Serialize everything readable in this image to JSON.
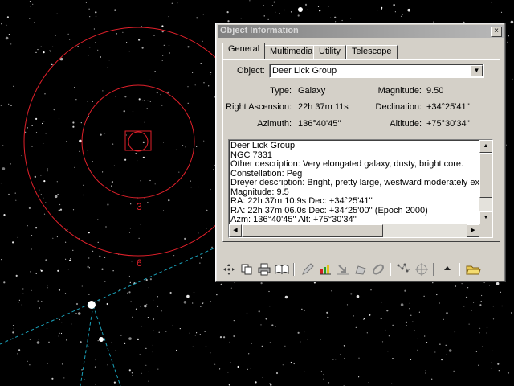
{
  "window": {
    "title": "Object Information",
    "close_glyph": "×"
  },
  "tabs": [
    {
      "label": "General",
      "active": true
    },
    {
      "label": "Multimedia",
      "active": false
    },
    {
      "label": "Utility",
      "active": false
    },
    {
      "label": "Telescope",
      "active": false
    }
  ],
  "general": {
    "object_label": "Object:",
    "object_value": "Deer Lick Group",
    "type_label": "Type:",
    "type_value": "Galaxy",
    "magnitude_label": "Magnitude:",
    "magnitude_value": "9.50",
    "ra_label": "Right Ascension:",
    "ra_value": "22h 37m 11s",
    "dec_label": "Declination:",
    "dec_value": "+34°25'41''",
    "azimuth_label": "Azimuth:",
    "azimuth_value": "136°40'45''",
    "altitude_label": "Altitude:",
    "altitude_value": "+75°30'34''"
  },
  "description": [
    "Deer Lick Group",
    "NGC 7331",
    "Other description: Very elongated galaxy, dusty, bright core.",
    "Constellation:  Peg",
    "Dreyer description: Bright, pretty large, westward moderately exten",
    "Magnitude:  9.5",
    "RA: 22h 37m 10.9s  Dec: +34°25'41''",
    "RA: 22h 37m 06.0s  Dec: +34°25'00''  (Epoch 2000)",
    "Azm: 136°40'45''  Alt: +75°30'34''"
  ],
  "sky": {
    "ring_labels": [
      "3",
      "6"
    ],
    "ring_color": "#e0202a",
    "line_color": "#1aa0b8"
  },
  "toolbar": [
    "center-object-icon",
    "copy-icon",
    "print-icon",
    "open-book-icon",
    "pencil-icon",
    "chart-edit-icon",
    "arrow-down-icon",
    "palette-icon",
    "link-icon",
    "constellation-icon",
    "crosshair-icon",
    "up-arrow-icon",
    "open-folder-icon"
  ]
}
